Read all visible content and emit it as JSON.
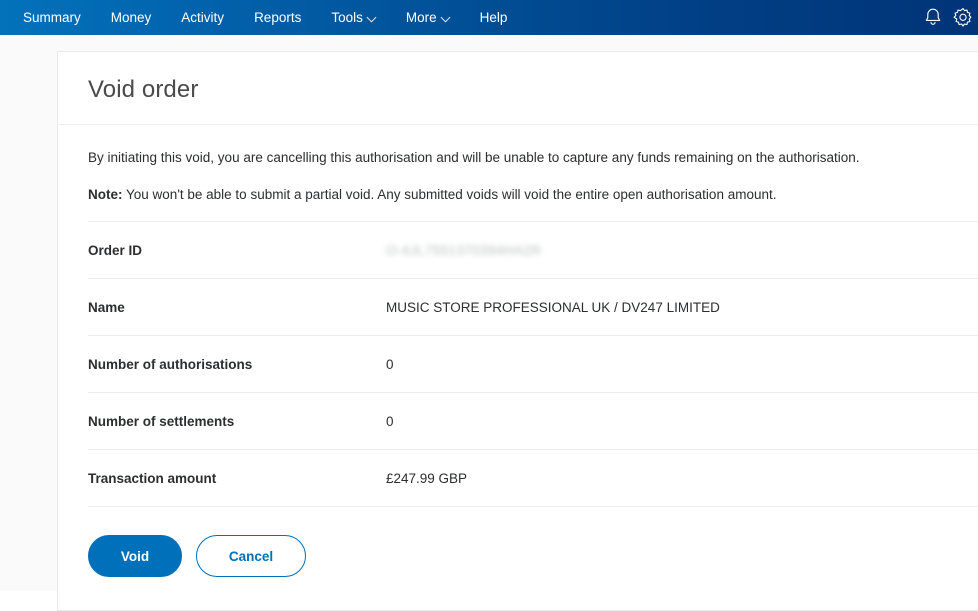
{
  "nav": {
    "items": [
      {
        "label": "Summary",
        "has_caret": false
      },
      {
        "label": "Money",
        "has_caret": false
      },
      {
        "label": "Activity",
        "has_caret": false
      },
      {
        "label": "Reports",
        "has_caret": false
      },
      {
        "label": "Tools",
        "has_caret": true
      },
      {
        "label": "More",
        "has_caret": true
      },
      {
        "label": "Help",
        "has_caret": false
      }
    ],
    "icons": [
      {
        "name": "bell-icon",
        "label": "Notifications"
      },
      {
        "name": "gear-icon",
        "label": "Settings"
      }
    ],
    "colors": {
      "gradient_start": "#0372bb",
      "gradient_end": "#013478",
      "text": "#ffffff"
    }
  },
  "card": {
    "title": "Void order",
    "intro": "By initiating this void, you are cancelling this authorisation and will be unable to capture any funds remaining on the authorisation.",
    "note_label": "Note:",
    "note_text": "You won't be able to submit a partial void. Any submitted voids will void the entire open authorisation amount.",
    "rows": [
      {
        "label": "Order ID",
        "value": "O-4JL7551370394HA2R",
        "redacted": true
      },
      {
        "label": "Name",
        "value": "MUSIC STORE PROFESSIONAL UK / DV247 LIMITED",
        "redacted": false
      },
      {
        "label": "Number of authorisations",
        "value": "0",
        "redacted": false
      },
      {
        "label": "Number of settlements",
        "value": "0",
        "redacted": false
      },
      {
        "label": "Transaction amount",
        "value": "£247.99 GBP",
        "redacted": false
      }
    ],
    "actions": {
      "primary_label": "Void",
      "secondary_label": "Cancel",
      "primary_color": "#0070ba"
    }
  }
}
